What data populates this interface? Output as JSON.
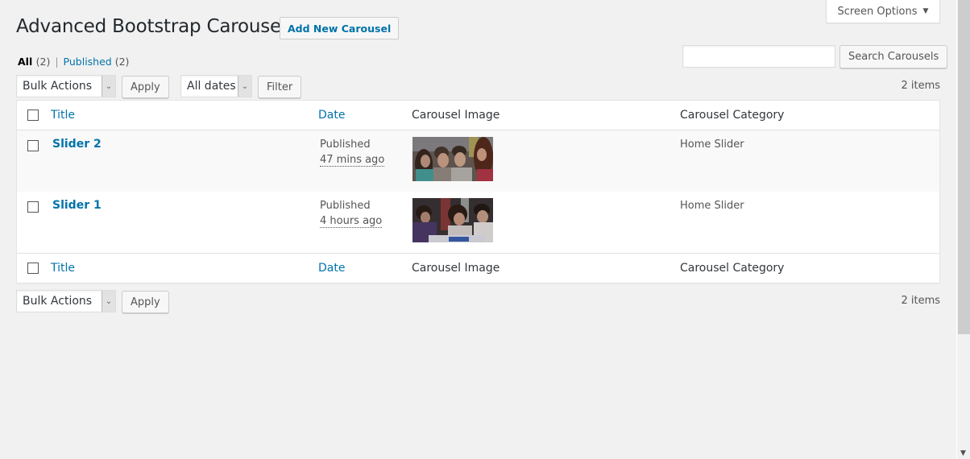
{
  "header": {
    "screen_options": "Screen Options",
    "screen_options_arrow": "▼",
    "title": "Advanced Bootstrap Carousel",
    "add_new": "Add New Carousel"
  },
  "filters": {
    "all_label": "All",
    "all_count": "(2)",
    "separator": "|",
    "published_label": "Published",
    "published_count": "(2)"
  },
  "search": {
    "value": "",
    "placeholder": "",
    "button": "Search Carousels"
  },
  "top_nav": {
    "bulk_actions": "Bulk Actions",
    "apply": "Apply",
    "dates": "All dates",
    "filter": "Filter",
    "items_count": "2 items"
  },
  "bottom_nav": {
    "bulk_actions": "Bulk Actions",
    "apply": "Apply",
    "items_count": "2 items"
  },
  "table": {
    "columns": {
      "title": "Title",
      "date": "Date",
      "image": "Carousel Image",
      "category": "Carousel Category"
    },
    "rows": [
      {
        "title": "Slider 2",
        "status": "Published",
        "ago": "47 mins ago",
        "image": "group-of-students-photo",
        "category": "Home Slider"
      },
      {
        "title": "Slider 1",
        "status": "Published",
        "ago": "4 hours ago",
        "image": "students-studying-photo",
        "category": "Home Slider"
      }
    ]
  },
  "icons": {
    "caret": "⌄",
    "scroll_down": "▼"
  }
}
